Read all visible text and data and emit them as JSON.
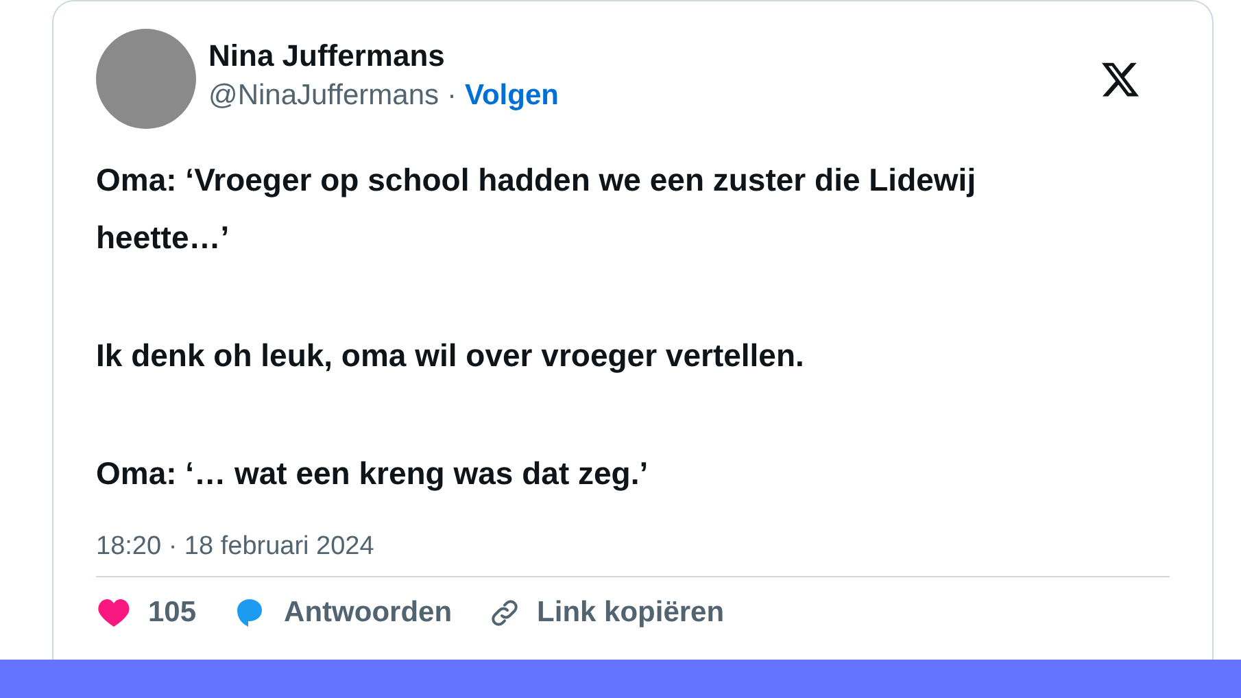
{
  "author": {
    "name": "Nina Juffermans",
    "handle": "@NinaJuffermans",
    "separator": "·",
    "follow": "Volgen"
  },
  "paragraphs": [
    "Oma: ‘Vroeger op school hadden we een zuster die Lidewij heette…’",
    "Ik denk oh leuk, oma wil over vroeger vertellen.",
    "Oma: ‘… wat een kreng was dat zeg.’"
  ],
  "timestamp": "18:20 · 18 februari 2024",
  "actions": [
    {
      "kind": "like",
      "label": "105"
    },
    {
      "kind": "reply",
      "label": "Antwoorden"
    },
    {
      "kind": "link",
      "label": "Link kopiëren"
    }
  ]
}
